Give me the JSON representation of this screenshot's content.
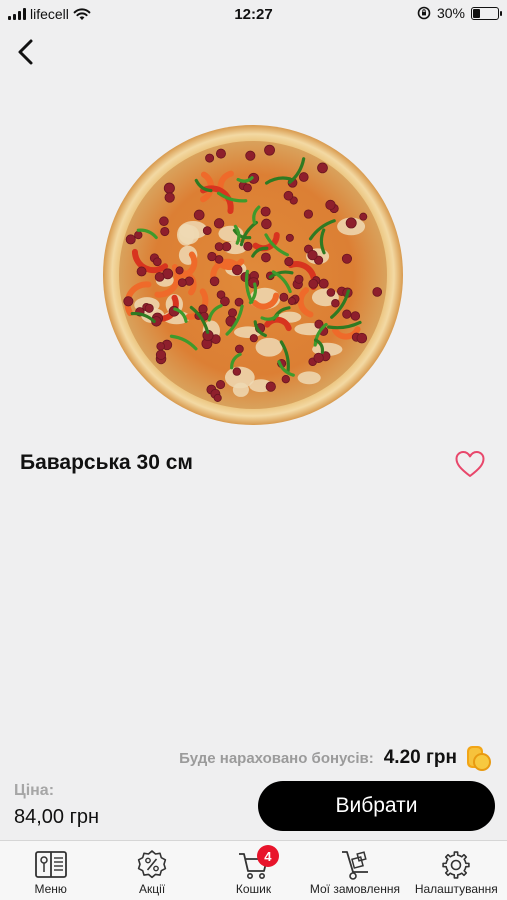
{
  "status_bar": {
    "carrier": "lifecell",
    "time": "12:27",
    "battery_percent": "30%",
    "battery_level": 0.3
  },
  "icons": {
    "back": "chevron-left-icon",
    "favorite": "heart-icon",
    "bonus": "coins-icon",
    "menu": "menu-book-icon",
    "promotions": "discount-badge-icon",
    "cart": "cart-icon",
    "orders": "hand-truck-icon",
    "settings": "gear-icon"
  },
  "product": {
    "title": "Баварська 30 см"
  },
  "bonus": {
    "label": "Буде нараховано бонусів:",
    "value": "4.20 грн"
  },
  "price": {
    "label": "Ціна:",
    "value": "84,00 грн"
  },
  "select_button": {
    "label": "Вибрати"
  },
  "colors": {
    "background": "#efeff0",
    "accent": "#000000",
    "heart": "#e8476b",
    "badge": "#e8142b",
    "coin": "#f5b817"
  },
  "tabs": [
    {
      "label": "Меню"
    },
    {
      "label": "Акції"
    },
    {
      "label": "Кошик",
      "badge": "4"
    },
    {
      "label": "Мої замовлення"
    },
    {
      "label": "Налаштування"
    }
  ]
}
